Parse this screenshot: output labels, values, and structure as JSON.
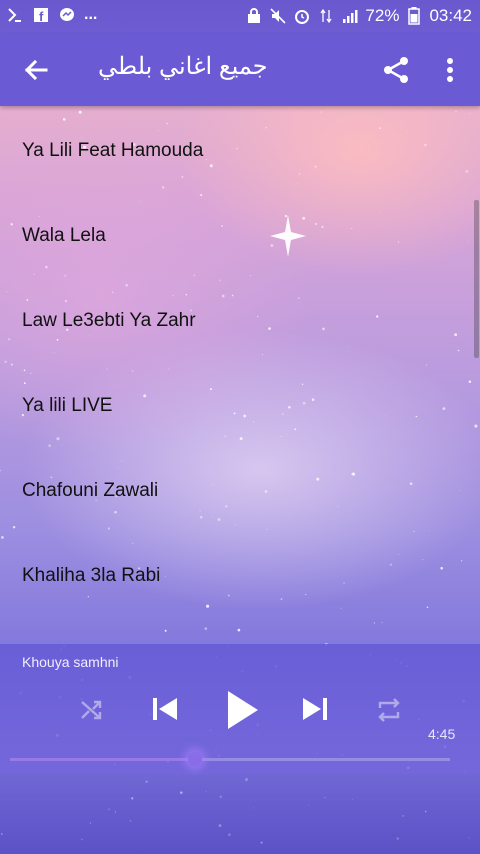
{
  "status_bar": {
    "left_icons": [
      "download-icon",
      "facebook-icon",
      "messenger-icon"
    ],
    "overflow": "...",
    "battery": "72%",
    "time": "03:42"
  },
  "app_bar": {
    "title": "جميع اغاني بلطي",
    "icons": {
      "back": "arrow-back-icon",
      "share": "share-icon",
      "menu": "more-vert-icon"
    }
  },
  "songs": [
    "Ya Lili Feat Hamouda",
    "Wala Lela",
    "Law Le3ebti Ya Zahr",
    "Ya lili LIVE",
    "Chafouni Zawali",
    "Khaliha 3la Rabi"
  ],
  "player": {
    "now_playing": "Khouya samhni",
    "duration": "4:45",
    "progress": 0.42,
    "controls": [
      "shuffle-icon",
      "skip-previous-icon",
      "play-icon",
      "skip-next-icon",
      "repeat-icon"
    ]
  },
  "colors": {
    "accent": "#6a5bd4",
    "status_bar": "#6a58cf"
  }
}
